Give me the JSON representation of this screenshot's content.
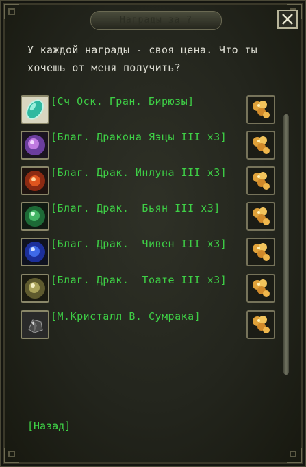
{
  "window": {
    "title": "Награды за ?",
    "close_icon": "close-icon"
  },
  "prompt": {
    "line1": "У каждой награды - своя цена. Что ты",
    "line2": "хочешь от меня получить?"
  },
  "rewards": [
    {
      "label": "[Сч Оск. Гран. Бирюзы]",
      "icon": "turquoise-gem-icon"
    },
    {
      "label": "[Благ. Дракона Яэцы III x3]",
      "icon": "purple-orb-icon"
    },
    {
      "label": "[Благ. Драк. Инлуна III x3]",
      "icon": "red-orb-icon"
    },
    {
      "label": "[Благ. Драк.  Бьян III x3]",
      "icon": "green-orb-icon"
    },
    {
      "label": "[Благ. Драк.  Чивен III x3]",
      "icon": "blue-orb-icon"
    },
    {
      "label": "[Благ. Драк.  Тоате III x3]",
      "icon": "gold-orb-icon"
    },
    {
      "label": "[М.Кристалл В. Сумрака]",
      "icon": "crystal-icon"
    }
  ],
  "exchange_icon": "gold-ore-icon",
  "back_link": "[Назад]",
  "colors": {
    "label_green": "#3ed046",
    "text_light": "#dcdcd2",
    "border_gold": "#8a8769"
  }
}
